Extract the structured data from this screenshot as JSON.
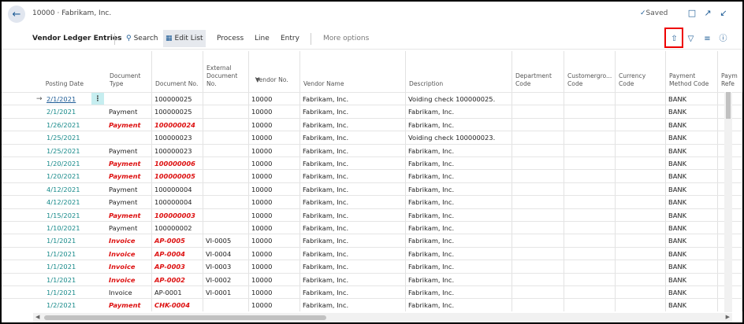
{
  "window": {
    "title": "10000 · Fabrikam, Inc.",
    "saved": "Saved"
  },
  "icons": {
    "back": "back-arrow-icon",
    "bookmark": "bookmark-icon",
    "open_new": "open-new-window-icon",
    "collapse": "collapse-icon"
  },
  "actionbar": {
    "title": "Vendor Ledger Entries",
    "search": "Search",
    "edit_list": "Edit List",
    "process": "Process",
    "line": "Line",
    "entry": "Entry",
    "more": "More options"
  },
  "columns": [
    {
      "key": "posting_date",
      "label": "Posting Date"
    },
    {
      "key": "doc_type",
      "label": "Document Type"
    },
    {
      "key": "doc_no",
      "label": "Document No."
    },
    {
      "key": "ext_doc_no",
      "label": "External Document No."
    },
    {
      "key": "vendor_no",
      "label": "Vendor No."
    },
    {
      "key": "vendor_name",
      "label": "Vendor Name"
    },
    {
      "key": "description",
      "label": "Description"
    },
    {
      "key": "dept_code",
      "label": "Department Code"
    },
    {
      "key": "custgroup_code",
      "label": "Customergro... Code"
    },
    {
      "key": "currency_code",
      "label": "Currency Code"
    },
    {
      "key": "payment_method",
      "label": "Payment Method Code"
    },
    {
      "key": "payment_ref",
      "label": "Paym Refe"
    }
  ],
  "rows": [
    {
      "posting_date": "2/1/2021",
      "doc_type": "",
      "doc_no": "100000025",
      "ext_doc_no": "",
      "vendor_no": "10000",
      "vendor_name": "Fabrikam, Inc.",
      "description": "Voiding check 100000025.",
      "payment_method": "BANK",
      "bold": false
    },
    {
      "posting_date": "2/1/2021",
      "doc_type": "Payment",
      "doc_no": "100000025",
      "ext_doc_no": "",
      "vendor_no": "10000",
      "vendor_name": "Fabrikam, Inc.",
      "description": "Fabrikam, Inc.",
      "payment_method": "BANK",
      "bold": false
    },
    {
      "posting_date": "1/26/2021",
      "doc_type": "Payment",
      "doc_no": "100000024",
      "ext_doc_no": "",
      "vendor_no": "10000",
      "vendor_name": "Fabrikam, Inc.",
      "description": "Fabrikam, Inc.",
      "payment_method": "BANK",
      "bold": true
    },
    {
      "posting_date": "1/25/2021",
      "doc_type": "",
      "doc_no": "100000023",
      "ext_doc_no": "",
      "vendor_no": "10000",
      "vendor_name": "Fabrikam, Inc.",
      "description": "Voiding check 100000023.",
      "payment_method": "BANK",
      "bold": false
    },
    {
      "posting_date": "1/25/2021",
      "doc_type": "Payment",
      "doc_no": "100000023",
      "ext_doc_no": "",
      "vendor_no": "10000",
      "vendor_name": "Fabrikam, Inc.",
      "description": "Fabrikam, Inc.",
      "payment_method": "BANK",
      "bold": false
    },
    {
      "posting_date": "1/20/2021",
      "doc_type": "Payment",
      "doc_no": "100000006",
      "ext_doc_no": "",
      "vendor_no": "10000",
      "vendor_name": "Fabrikam, Inc.",
      "description": "Fabrikam, Inc.",
      "payment_method": "BANK",
      "bold": true
    },
    {
      "posting_date": "1/20/2021",
      "doc_type": "Payment",
      "doc_no": "100000005",
      "ext_doc_no": "",
      "vendor_no": "10000",
      "vendor_name": "Fabrikam, Inc.",
      "description": "Fabrikam, Inc.",
      "payment_method": "BANK",
      "bold": true
    },
    {
      "posting_date": "4/12/2021",
      "doc_type": "Payment",
      "doc_no": "100000004",
      "ext_doc_no": "",
      "vendor_no": "10000",
      "vendor_name": "Fabrikam, Inc.",
      "description": "Fabrikam, Inc.",
      "payment_method": "BANK",
      "bold": false
    },
    {
      "posting_date": "4/12/2021",
      "doc_type": "Payment",
      "doc_no": "100000004",
      "ext_doc_no": "",
      "vendor_no": "10000",
      "vendor_name": "Fabrikam, Inc.",
      "description": "Fabrikam, Inc.",
      "payment_method": "BANK",
      "bold": false
    },
    {
      "posting_date": "1/15/2021",
      "doc_type": "Payment",
      "doc_no": "100000003",
      "ext_doc_no": "",
      "vendor_no": "10000",
      "vendor_name": "Fabrikam, Inc.",
      "description": "Fabrikam, Inc.",
      "payment_method": "BANK",
      "bold": true
    },
    {
      "posting_date": "1/10/2021",
      "doc_type": "Payment",
      "doc_no": "100000002",
      "ext_doc_no": "",
      "vendor_no": "10000",
      "vendor_name": "Fabrikam, Inc.",
      "description": "Fabrikam, Inc.",
      "payment_method": "BANK",
      "bold": false
    },
    {
      "posting_date": "1/1/2021",
      "doc_type": "Invoice",
      "doc_no": "AP-0005",
      "ext_doc_no": "VI-0005",
      "vendor_no": "10000",
      "vendor_name": "Fabrikam, Inc.",
      "description": "Fabrikam, Inc.",
      "payment_method": "BANK",
      "bold": true
    },
    {
      "posting_date": "1/1/2021",
      "doc_type": "Invoice",
      "doc_no": "AP-0004",
      "ext_doc_no": "VI-0004",
      "vendor_no": "10000",
      "vendor_name": "Fabrikam, Inc.",
      "description": "Fabrikam, Inc.",
      "payment_method": "BANK",
      "bold": true
    },
    {
      "posting_date": "1/1/2021",
      "doc_type": "Invoice",
      "doc_no": "AP-0003",
      "ext_doc_no": "VI-0003",
      "vendor_no": "10000",
      "vendor_name": "Fabrikam, Inc.",
      "description": "Fabrikam, Inc.",
      "payment_method": "BANK",
      "bold": true
    },
    {
      "posting_date": "1/1/2021",
      "doc_type": "Invoice",
      "doc_no": "AP-0002",
      "ext_doc_no": "VI-0002",
      "vendor_no": "10000",
      "vendor_name": "Fabrikam, Inc.",
      "description": "Fabrikam, Inc.",
      "payment_method": "BANK",
      "bold": true
    },
    {
      "posting_date": "1/1/2021",
      "doc_type": "Invoice",
      "doc_no": "AP-0001",
      "ext_doc_no": "VI-0001",
      "vendor_no": "10000",
      "vendor_name": "Fabrikam, Inc.",
      "description": "Fabrikam, Inc.",
      "payment_method": "BANK",
      "bold": false
    },
    {
      "posting_date": "1/2/2021",
      "doc_type": "Payment",
      "doc_no": "CHK-0004",
      "ext_doc_no": "",
      "vendor_no": "10000",
      "vendor_name": "Fabrikam, Inc.",
      "description": "Fabrikam, Inc.",
      "payment_method": "BANK",
      "bold": true
    }
  ],
  "colors": {
    "accent": "#1e5c96",
    "date": "#188a8a",
    "highlight": "#e00000",
    "emphasis": "#dd1111"
  }
}
